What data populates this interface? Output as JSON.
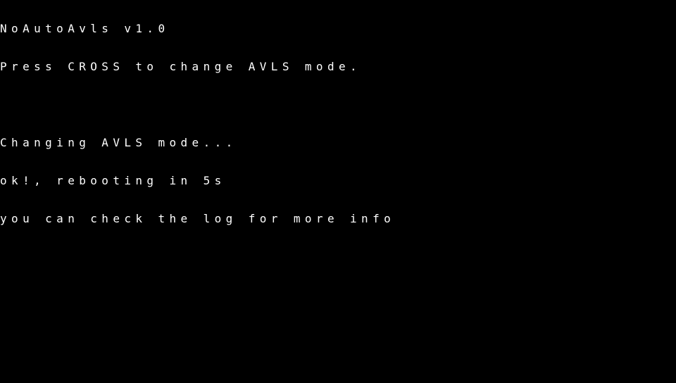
{
  "screen": {
    "background_color": "#000000",
    "text_color": "#ffffff"
  },
  "console": {
    "lines": [
      "NoAutoAvls v1.0",
      "Press CROSS to change AVLS mode.",
      "",
      "Changing AVLS mode...",
      "ok!, rebooting in 5s",
      "you can check the log for more info"
    ]
  }
}
